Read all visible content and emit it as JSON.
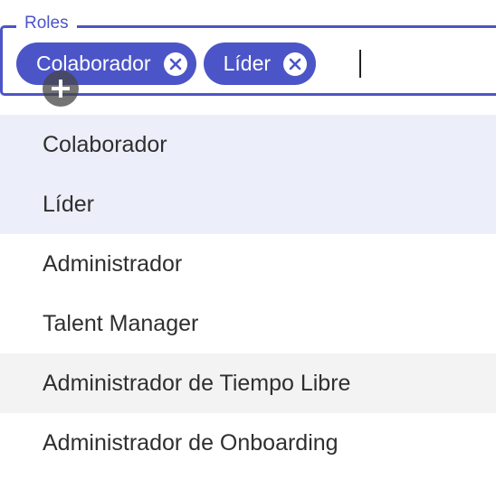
{
  "field": {
    "label": "Roles",
    "accent_color": "#4c55c7"
  },
  "chips": [
    {
      "label": "Colaborador",
      "icon": "close-circle-icon"
    },
    {
      "label": "Líder",
      "icon": "close-circle-icon"
    }
  ],
  "add_icon": "plus-icon",
  "options": [
    {
      "label": "Colaborador",
      "state": "selected"
    },
    {
      "label": "Líder",
      "state": "selected"
    },
    {
      "label": "Administrador",
      "state": "default"
    },
    {
      "label": "Talent Manager",
      "state": "default"
    },
    {
      "label": "Administrador de Tiempo Libre",
      "state": "hovered"
    },
    {
      "label": "Administrador de Onboarding",
      "state": "default"
    }
  ]
}
